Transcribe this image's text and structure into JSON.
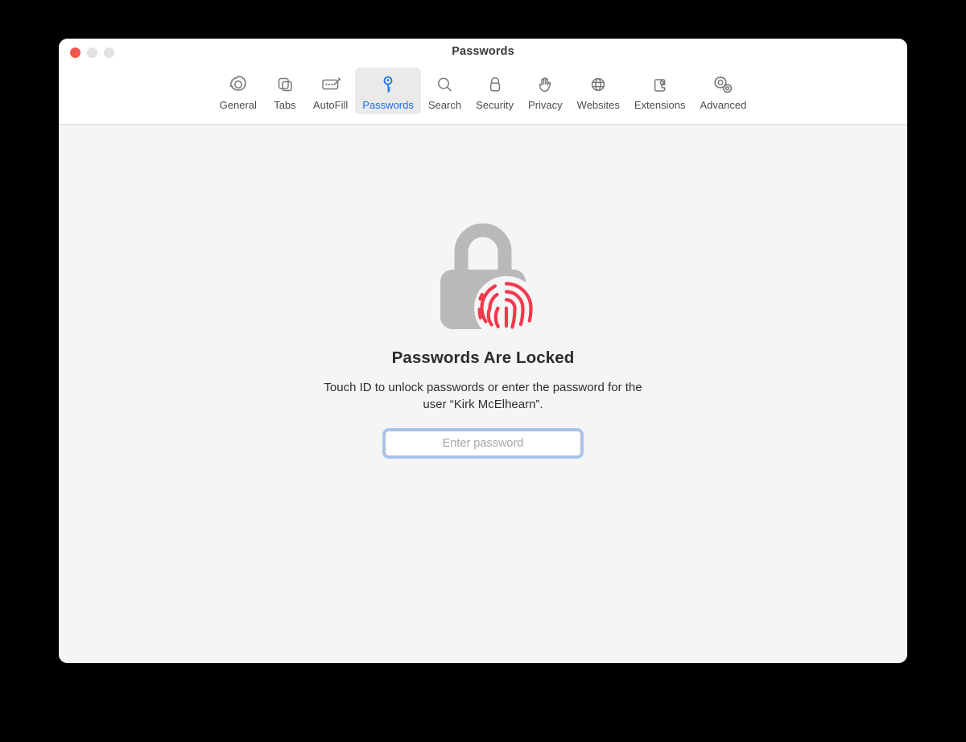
{
  "window": {
    "title": "Passwords",
    "controls": [
      {
        "name": "close",
        "color": "#f2584c"
      },
      {
        "name": "minimize",
        "color": "#e2e2e2"
      },
      {
        "name": "maximize",
        "color": "#e2e2e2"
      }
    ]
  },
  "toolbar": {
    "selected": "Passwords",
    "tabs": [
      {
        "label": "General",
        "icon": "gear-icon"
      },
      {
        "label": "Tabs",
        "icon": "tabs-icon"
      },
      {
        "label": "AutoFill",
        "icon": "autofill-icon"
      },
      {
        "label": "Passwords",
        "icon": "key-icon"
      },
      {
        "label": "Search",
        "icon": "search-icon"
      },
      {
        "label": "Security",
        "icon": "lock-icon"
      },
      {
        "label": "Privacy",
        "icon": "hand-icon"
      },
      {
        "label": "Websites",
        "icon": "globe-icon"
      },
      {
        "label": "Extensions",
        "icon": "puzzle-icon"
      },
      {
        "label": "Advanced",
        "icon": "gears-icon"
      }
    ]
  },
  "main": {
    "artwork": {
      "icon": "lock-with-fingerprint-icon",
      "lock_color": "#b9b9b9",
      "fingerprint_color": "#f2394d"
    },
    "headline": "Passwords Are Locked",
    "subtext": "Touch ID to unlock passwords or enter the password for the user “Kirk McElhearn”.",
    "password_field": {
      "value": "",
      "placeholder": "Enter password",
      "focused": true,
      "focus_ring_color": "#468cf5"
    }
  },
  "colors": {
    "accent": "#1570ef",
    "toolbar_bg": "#ffffff",
    "content_bg": "#f5f5f5",
    "selected_tab_bg": "#eaeaea",
    "label": "#4c4c4e"
  }
}
